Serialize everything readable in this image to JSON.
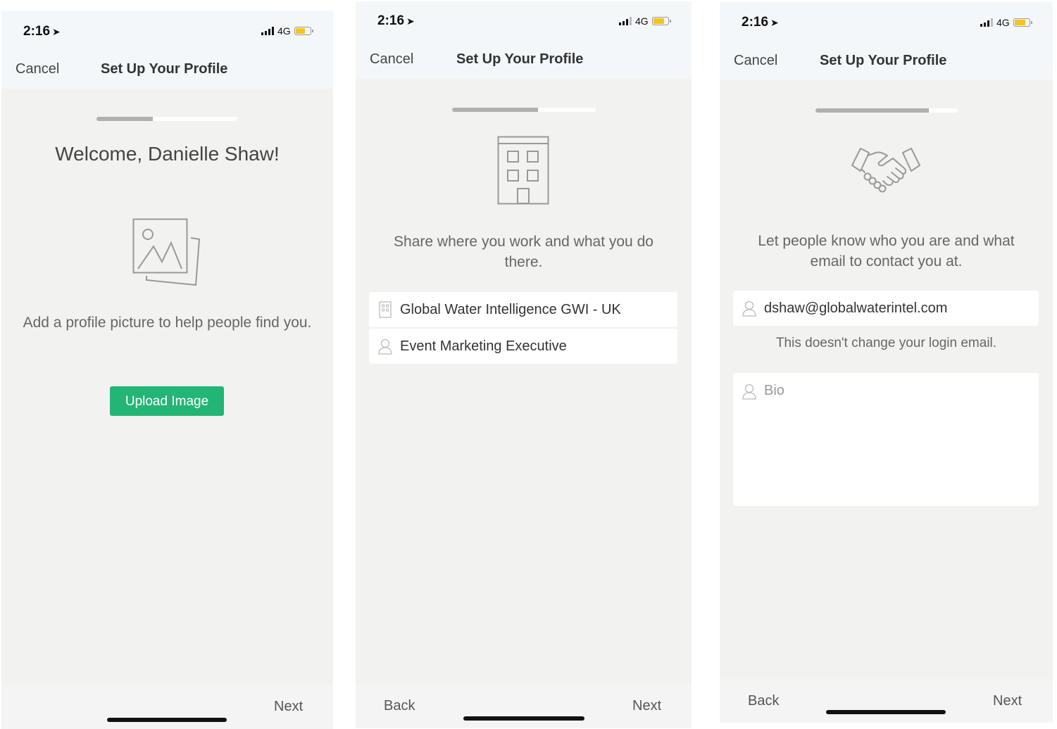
{
  "screens": [
    {
      "status": {
        "time": "2:16",
        "network": "4G"
      },
      "header": {
        "cancel": "Cancel",
        "title": "Set Up Your Profile"
      },
      "progress": 0.4,
      "welcome": "Welcome, Danielle Shaw!",
      "icon": "picture-icon",
      "description": "Add a profile picture to help people find you.",
      "upload_button": "Upload Image",
      "footer": {
        "next": "Next"
      }
    },
    {
      "status": {
        "time": "2:16",
        "network": "4G"
      },
      "header": {
        "cancel": "Cancel",
        "title": "Set Up Your Profile"
      },
      "progress": 0.6,
      "icon": "building-icon",
      "description": "Share where you work and what you do there.",
      "fields": [
        {
          "icon": "building-small-icon",
          "value": "Global Water Intelligence GWI - UK"
        },
        {
          "icon": "person-icon",
          "value": "Event Marketing Executive"
        }
      ],
      "footer": {
        "back": "Back",
        "next": "Next"
      }
    },
    {
      "status": {
        "time": "2:16",
        "network": "4G"
      },
      "header": {
        "cancel": "Cancel",
        "title": "Set Up Your Profile"
      },
      "progress": 0.8,
      "icon": "handshake-icon",
      "description": "Let people know who you are and what email to contact you at.",
      "email": "dshaw@globalwaterintel.com",
      "email_note": "This doesn't change your login email.",
      "bio_placeholder": "Bio",
      "footer": {
        "back": "Back",
        "next": "Next"
      }
    }
  ],
  "colors": {
    "accent": "#23b576",
    "battery": "#f6c51a",
    "background": "#f2f2f1",
    "header": "#f4f7fa"
  }
}
